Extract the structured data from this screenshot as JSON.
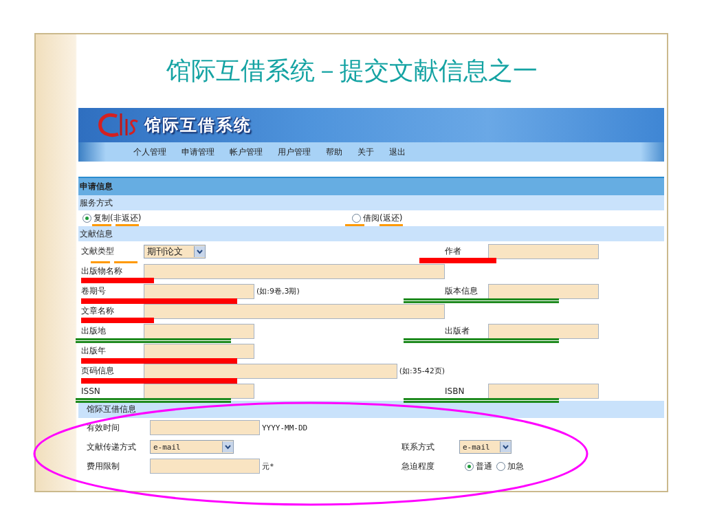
{
  "title": "馆际互借系统－提交文献信息之一",
  "banner": {
    "logo_title": "馆际互借系统"
  },
  "nav": [
    "个人管理",
    "申请管理",
    "帐户管理",
    "用户管理",
    "帮助",
    "关于",
    "退出"
  ],
  "request": {
    "heading": "申请信息",
    "service": {
      "heading": "服务方式",
      "options": [
        {
          "label": "复制(非返还)",
          "selected": true,
          "mark": {
            "kind": "dashes",
            "color": "#ff9900"
          }
        },
        {
          "label": "借阅(返还)",
          "selected": false,
          "mark": {
            "kind": "dashes",
            "color": "#ff9900"
          }
        }
      ]
    },
    "document": {
      "heading": "文献信息",
      "rows": [
        {
          "left": {
            "label": "文献类型",
            "kind": "select",
            "value": "期刊论文",
            "mark": {
              "kind": "dashes",
              "color": "#ff9900"
            }
          },
          "right": {
            "label": "作者",
            "kind": "short-input",
            "mark": {
              "kind": "bar",
              "color": "#ff0000"
            }
          }
        },
        {
          "left": {
            "label": "出版物名称",
            "kind": "long-input",
            "mark": {
              "kind": "bar",
              "color": "#ff0000"
            }
          }
        },
        {
          "left": {
            "label": "卷期号",
            "kind": "short-input",
            "note": "(如:9卷,3期)",
            "mark": {
              "kind": "wide-bar",
              "color": "#ff0000"
            }
          },
          "right": {
            "label": "版本信息",
            "kind": "short-input",
            "mark": {
              "kind": "double",
              "color": "#1e8a1e"
            }
          }
        },
        {
          "left": {
            "label": "文章名称",
            "kind": "long-input",
            "mark": {
              "kind": "bar",
              "color": "#ff0000"
            }
          }
        },
        {
          "left": {
            "label": "出版地",
            "kind": "short-input",
            "mark": {
              "kind": "double",
              "color": "#1e8a1e"
            }
          },
          "right": {
            "label": "出版者",
            "kind": "short-input",
            "mark": {
              "kind": "double",
              "color": "#1e8a1e"
            }
          }
        },
        {
          "left": {
            "label": "出版年",
            "kind": "short-input",
            "mark": {
              "kind": "wide-bar",
              "color": "#ff0000"
            }
          }
        },
        {
          "left": {
            "label": "页码信息",
            "kind": "long-input",
            "note": "(如:35-42页)",
            "mark": {
              "kind": "wide-bar",
              "color": "#ff0000"
            }
          }
        },
        {
          "left": {
            "label": "ISSN",
            "kind": "short-input",
            "mark": {
              "kind": "double",
              "color": "#1e8a1e"
            }
          },
          "right": {
            "label": "ISBN",
            "kind": "short-input",
            "mark": {
              "kind": "double",
              "color": "#1e8a1e"
            }
          }
        }
      ]
    }
  },
  "ill": {
    "heading": "馆际互借信息",
    "rows": [
      {
        "left": {
          "label": "有效时间",
          "kind": "short-input",
          "note": "YYYY-MM-DD"
        }
      },
      {
        "left": {
          "label": "文献传递方式",
          "kind": "select",
          "value": "e-mail"
        },
        "right": {
          "label": "联系方式",
          "kind": "select",
          "value": "e-mail"
        }
      },
      {
        "left": {
          "label": "费用限制",
          "kind": "short-input",
          "note": "元*"
        },
        "right": {
          "label": "急迫程度",
          "kind": "radios",
          "options": [
            {
              "label": "普通",
              "selected": true
            },
            {
              "label": "加急",
              "selected": false
            }
          ]
        }
      }
    ]
  }
}
